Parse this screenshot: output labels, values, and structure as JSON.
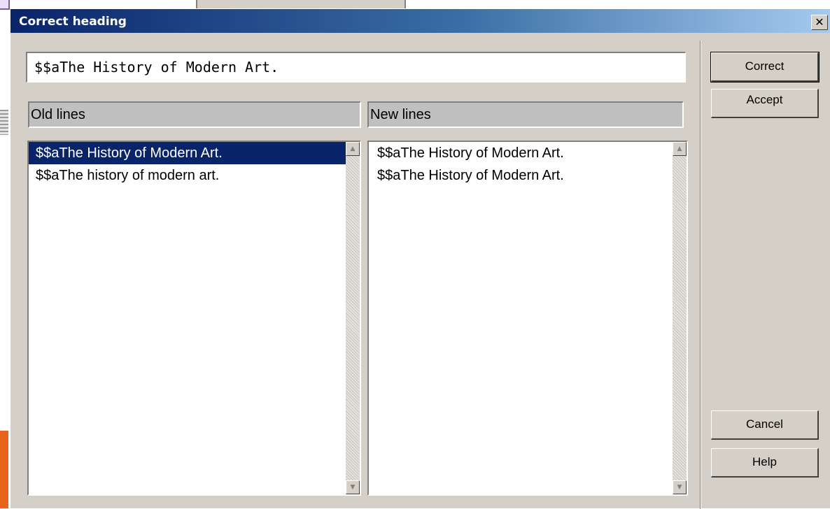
{
  "window": {
    "title": "Correct heading",
    "close_glyph": "✕"
  },
  "heading_input": {
    "value": "$$aThe History of Modern Art."
  },
  "old_lines": {
    "header": "Old lines",
    "items": [
      "$$aThe History of Modern Art.",
      "$$aThe history of modern art."
    ],
    "selected_index": 0
  },
  "new_lines": {
    "header": "New lines",
    "items": [
      "$$aThe History of Modern Art.",
      "$$aThe History of Modern Art."
    ]
  },
  "buttons": {
    "correct": "Correct",
    "accept": "Accept",
    "cancel": "Cancel",
    "help": "Help"
  },
  "colors": {
    "title_gradient_start": "#0a246a",
    "title_gradient_end": "#a6caf0",
    "selection": "#0a246a",
    "dialog_face": "#d4d0c8"
  }
}
